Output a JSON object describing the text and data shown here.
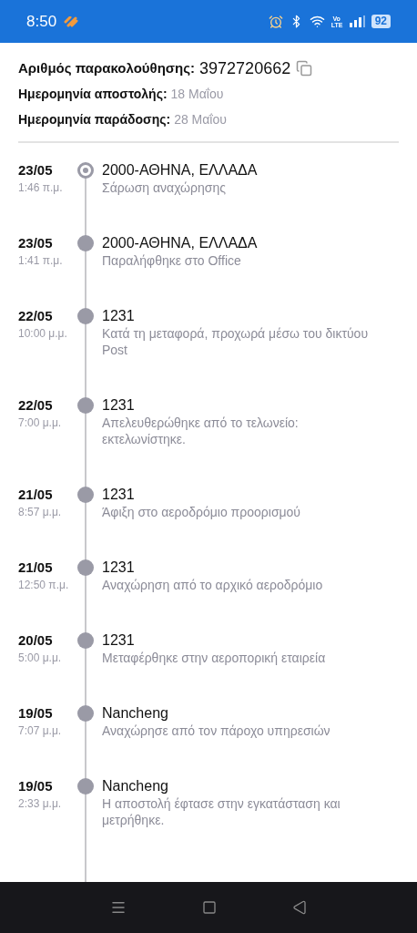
{
  "status_bar": {
    "time": "8:50",
    "network": "Vo LTE",
    "battery": "92"
  },
  "shipment": {
    "tracking_label": "Αριθμός παρακολούθησης:",
    "tracking_number": "3972720662",
    "sent_label": "Ημερομηνία αποστολής:",
    "sent_date": "18 Μαΐου",
    "delivery_label": "Ημερομηνία παράδοσης:",
    "delivery_date": "28 Μαΐου"
  },
  "events": [
    {
      "date": "23/05",
      "time": "1:46 π.μ.",
      "place": "2000-ΑΘΗΝΑ, ΕΛΛΑΔΑ",
      "status": "Σάρωση αναχώρησης",
      "current": true
    },
    {
      "date": "23/05",
      "time": "1:41 π.μ.",
      "place": "2000-ΑΘΗΝΑ, ΕΛΛΑΔΑ",
      "status": "Παραλήφθηκε στο Office",
      "current": false
    },
    {
      "date": "22/05",
      "time": "10:00 μ.μ.",
      "place": "1231",
      "status": "Κατά τη μεταφορά, προχωρά μέσω του δικτύου Post",
      "current": false
    },
    {
      "date": "22/05",
      "time": "7:00 μ.μ.",
      "place": "1231",
      "status": "Απελευθερώθηκε από το τελωνείο: εκτελωνίστηκε.",
      "current": false
    },
    {
      "date": "21/05",
      "time": "8:57 μ.μ.",
      "place": "1231",
      "status": "Άφιξη στο αεροδρόμιο προορισμού",
      "current": false
    },
    {
      "date": "21/05",
      "time": "12:50 π.μ.",
      "place": "1231",
      "status": "Αναχώρηση από το αρχικό αεροδρόμιο",
      "current": false
    },
    {
      "date": "20/05",
      "time": "5:00 μ.μ.",
      "place": "1231",
      "status": "Μεταφέρθηκε στην αεροπορική εταιρεία",
      "current": false
    },
    {
      "date": "19/05",
      "time": "7:07 μ.μ.",
      "place": "Nancheng",
      "status": "Αναχώρησε από τον πάροχο υπηρεσιών",
      "current": false
    },
    {
      "date": "19/05",
      "time": "2:33 μ.μ.",
      "place": "Nancheng",
      "status": "Η αποστολή έφτασε στην εγκατάσταση και μετρήθηκε.",
      "current": false
    }
  ]
}
